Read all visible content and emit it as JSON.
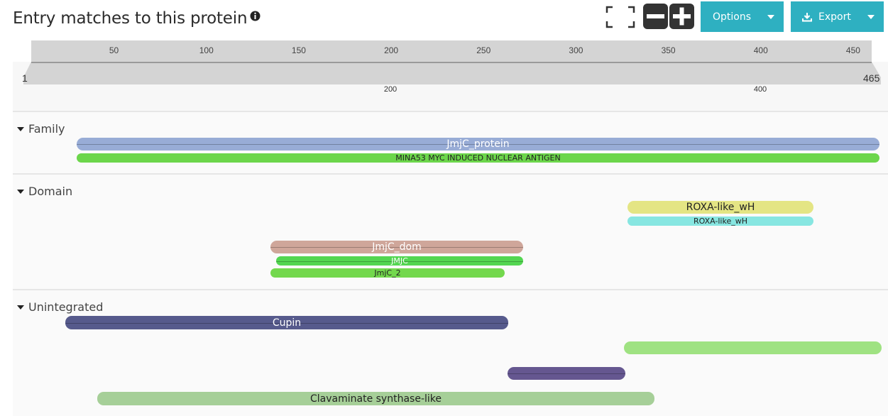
{
  "header": {
    "title": "Entry matches to this protein",
    "options_label": "Options",
    "export_label": "Export"
  },
  "ruler": {
    "start": "1",
    "end": "465",
    "ticks": [
      "50",
      "100",
      "150",
      "200",
      "250",
      "300",
      "350",
      "400",
      "450"
    ],
    "axis_labels": [
      "200",
      "400"
    ]
  },
  "sections": [
    {
      "label": "Family",
      "tracks": [
        {
          "label": "JmjC_protein",
          "color": "#98acd6"
        },
        {
          "label": "MINA53 MYC INDUCED NUCLEAR ANTIGEN",
          "color": "#6cd64b"
        }
      ]
    },
    {
      "label": "Domain",
      "tracks": [
        {
          "label": "ROXA-like_wH",
          "color": "#e4e584"
        },
        {
          "label": "ROXA-like_wH",
          "color": "#87e6e1"
        },
        {
          "label": "JmjC_dom",
          "color": "#cfa69a"
        },
        {
          "label": "JMJC",
          "color": "#53d651"
        },
        {
          "label": "JmjC_2",
          "color": "#73d84d"
        }
      ]
    },
    {
      "label": "Unintegrated",
      "tracks": [
        {
          "label": "Cupin",
          "color": "#565a8c"
        },
        {
          "label": "",
          "color": "#9fe282"
        },
        {
          "label": "",
          "color": "#655790"
        },
        {
          "label": "Clavaminate synthase-like",
          "color": "#a6cf98"
        }
      ]
    }
  ]
}
